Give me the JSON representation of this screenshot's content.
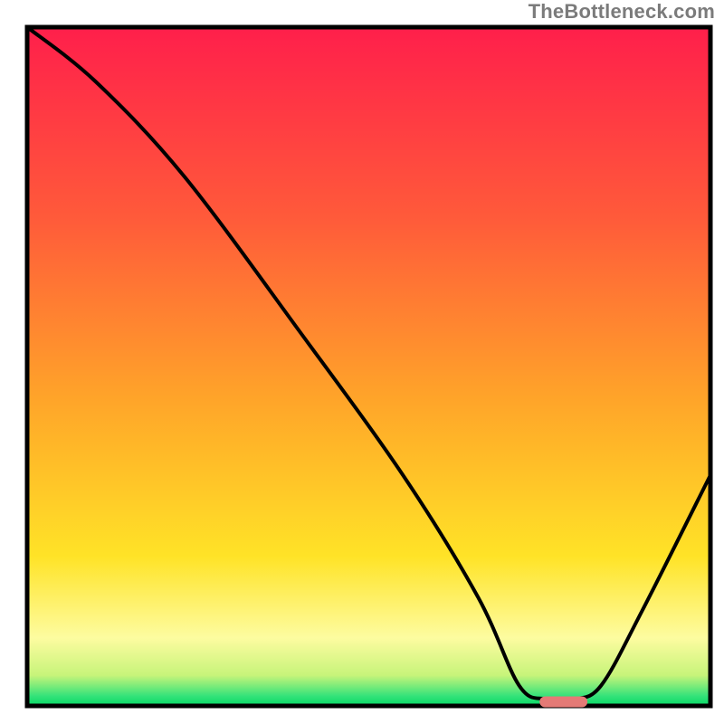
{
  "watermark": "TheBottleneck.com",
  "chart_data": {
    "type": "line",
    "title": "",
    "xlabel": "",
    "ylabel": "",
    "xlim": [
      0,
      100
    ],
    "ylim": [
      0,
      100
    ],
    "grid": false,
    "legend": false,
    "axes_visible": false,
    "background": {
      "type": "vertical-gradient",
      "stops": [
        {
          "offset": 0.0,
          "color": "#ff1f4b"
        },
        {
          "offset": 0.28,
          "color": "#ff5a3a"
        },
        {
          "offset": 0.55,
          "color": "#ffa529"
        },
        {
          "offset": 0.78,
          "color": "#ffe327"
        },
        {
          "offset": 0.9,
          "color": "#fdfca0"
        },
        {
          "offset": 0.955,
          "color": "#c7f47a"
        },
        {
          "offset": 0.985,
          "color": "#36e37a"
        },
        {
          "offset": 1.0,
          "color": "#05d765"
        }
      ]
    },
    "series": [
      {
        "name": "bottleneck-curve",
        "color": "#000000",
        "x": [
          0,
          10,
          23,
          40,
          55,
          66,
          72,
          76,
          80,
          84,
          90,
          100
        ],
        "y": [
          100,
          92,
          78,
          55,
          34,
          16,
          3,
          1,
          1,
          3,
          14,
          34
        ]
      }
    ],
    "marker": {
      "name": "optimal-range",
      "shape": "rounded-bar",
      "color": "#e47a76",
      "x_start": 75,
      "x_end": 82,
      "y": 0.6,
      "height": 1.6
    }
  }
}
